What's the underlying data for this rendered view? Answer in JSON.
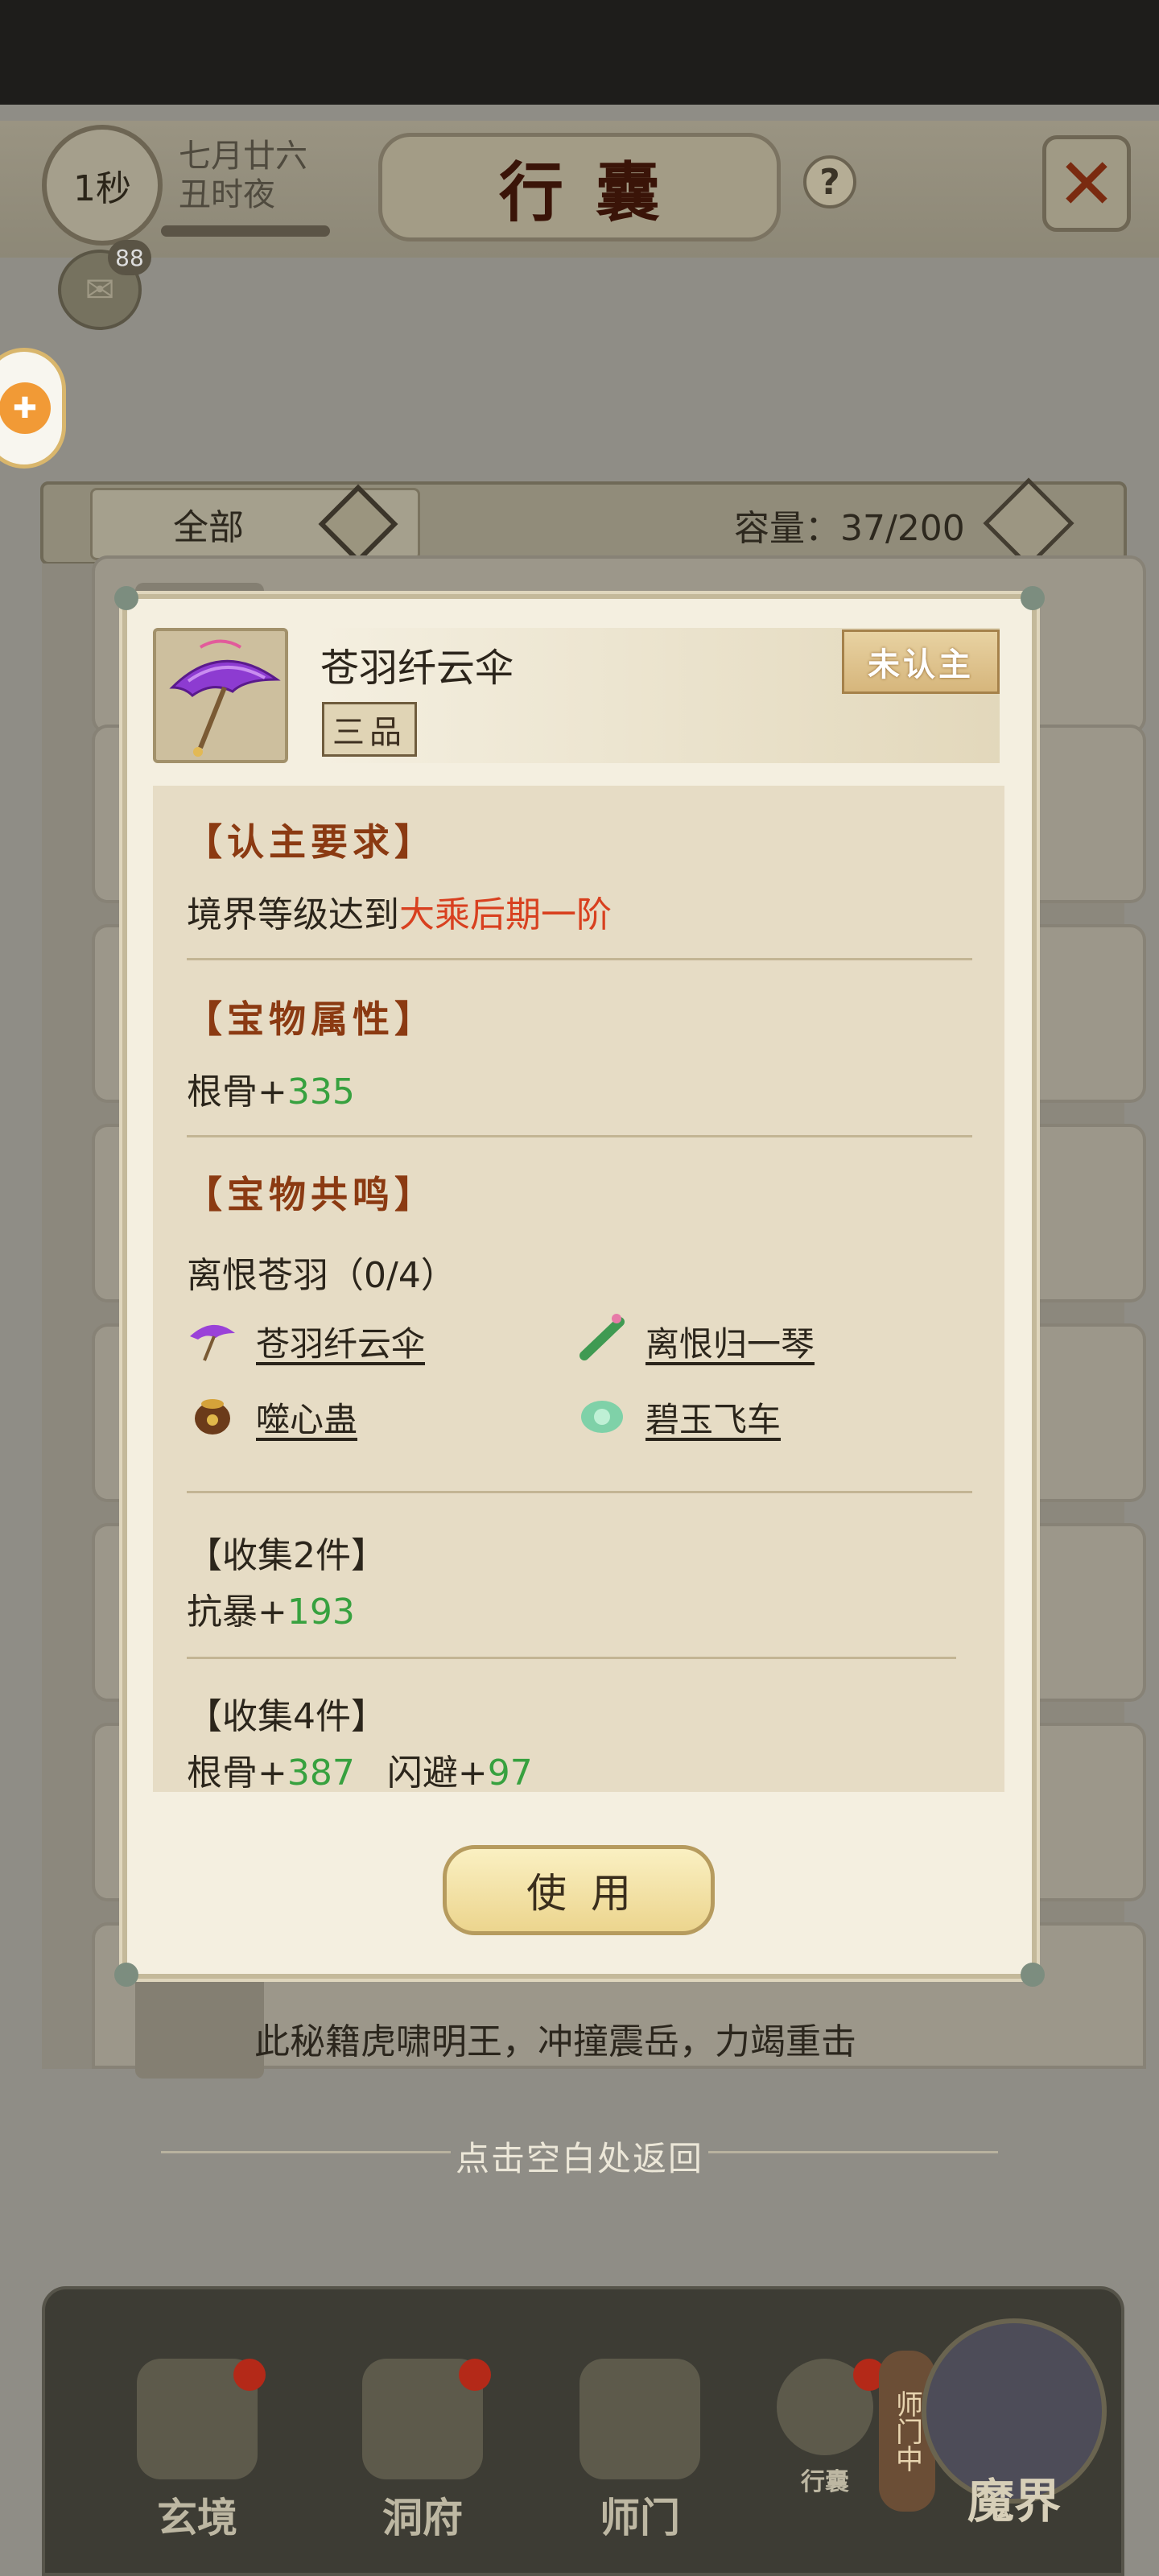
{
  "header": {
    "timer": "1秒",
    "date_line1": "七月廿六",
    "date_line2": "丑时夜",
    "title": "行囊",
    "help_icon": "?",
    "close_icon": "close-x-icon"
  },
  "chat": {
    "badge_count": "88"
  },
  "filter": {
    "selected": "全部",
    "capacity_label": "容量：",
    "capacity_value": "37/200"
  },
  "list": {
    "last_item_description": "此秘籍虎啸明王，冲撞震岳，力竭重击"
  },
  "back_hint": "点击空白处返回",
  "modal": {
    "item_name": "苍羽纤云伞",
    "grade": "三品",
    "status_badge": "未认主",
    "requirement_title": "【认主要求】",
    "requirement_prefix": "境界等级达到",
    "requirement_value": "大乘后期一阶",
    "attributes_title": "【宝物属性】",
    "attribute": {
      "name": "根骨+",
      "value": "335"
    },
    "resonance_title": "【宝物共鸣】",
    "set_name": "离恨苍羽（0/4）",
    "set_items": [
      {
        "name": "苍羽纤云伞",
        "icon": "umbrella-icon"
      },
      {
        "name": "离恨归一琴",
        "icon": "qin-instrument-icon"
      },
      {
        "name": "噬心蛊",
        "icon": "gu-jar-icon"
      },
      {
        "name": "碧玉飞车",
        "icon": "jade-chariot-icon"
      }
    ],
    "bonus2_title": "【收集2件】",
    "bonus2": {
      "name": "抗暴+",
      "value": "193"
    },
    "bonus4_title": "【收集4件】",
    "bonus4": [
      {
        "name": "根骨+",
        "value": "387"
      },
      {
        "name": "闪避+",
        "value": "97"
      }
    ],
    "use_button": "使用"
  },
  "bottom_nav": [
    {
      "label": "玄境",
      "icon": "scroll-icon",
      "alert": true
    },
    {
      "label": "洞府",
      "icon": "lantern-icon",
      "alert": true
    },
    {
      "label": "师门",
      "icon": "banner-icon",
      "alert": false
    },
    {
      "label": "行囊",
      "icon": "bag-icon",
      "alert": true
    }
  ],
  "side_tag": "师门中",
  "portal_label": "魔界",
  "colors": {
    "accent_red": "#d8401f",
    "stat_green": "#37a13f",
    "section_brown": "#8b3a12"
  }
}
